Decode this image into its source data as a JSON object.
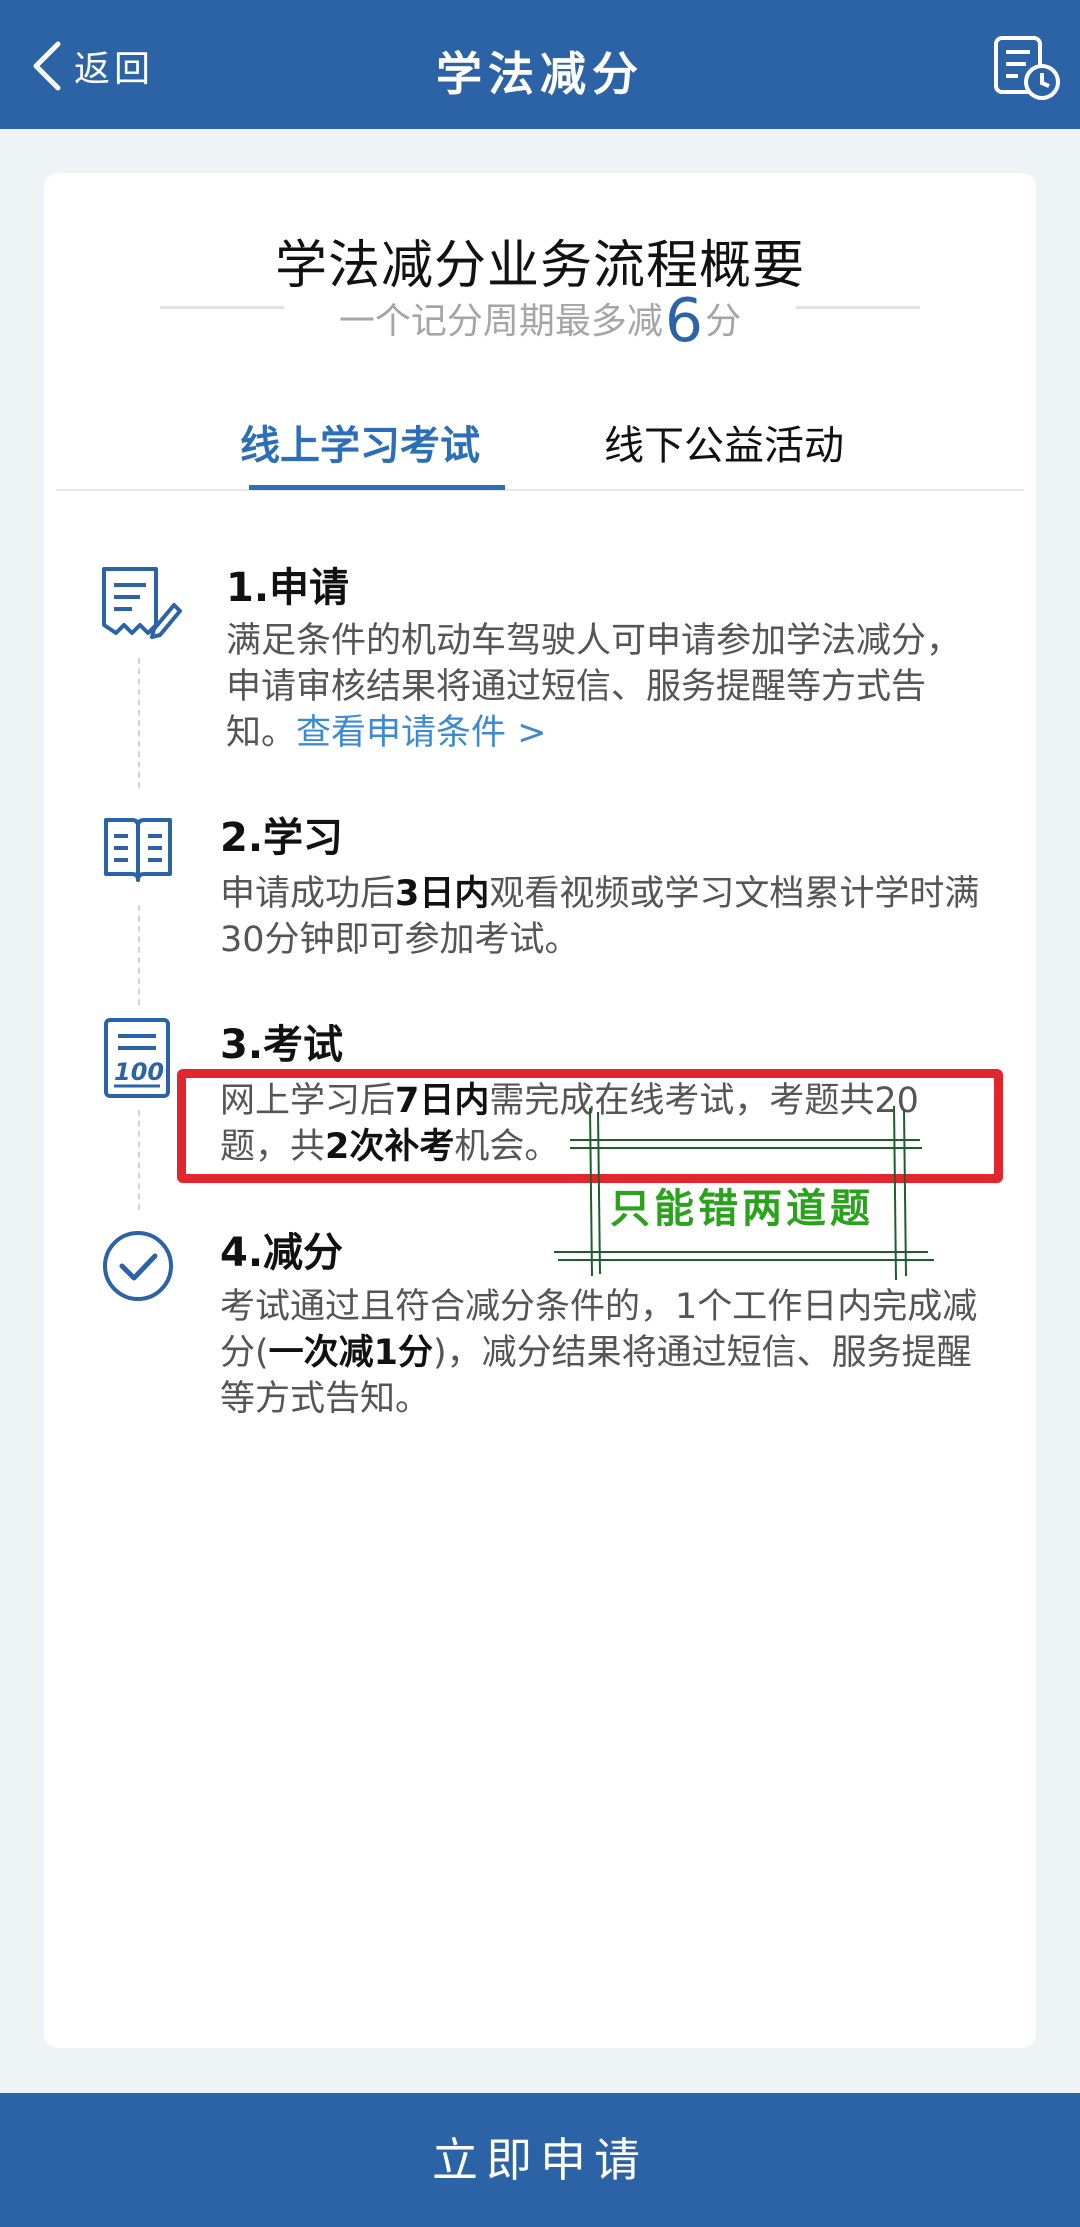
{
  "header": {
    "back_label": "返回",
    "title": "学法减分"
  },
  "card": {
    "title": "学法减分业务流程概要",
    "subtitle_prefix": "一个记分周期最多减",
    "subtitle_number": "6",
    "subtitle_suffix": "分"
  },
  "tabs": [
    {
      "label": "线上学习考试",
      "active": true
    },
    {
      "label": "线下公益活动",
      "active": false
    }
  ],
  "steps": [
    {
      "title": "1.申请",
      "desc": "满足条件的机动车驾驶人可申请参加学法减分，申请审核结果将通过短信、服务提醒等方式告知。",
      "link": "查看申请条件 >"
    },
    {
      "title": "2.学习",
      "desc_a": "申请成功后",
      "desc_b": "3日内",
      "desc_c": "观看视频或学习文档累计学时满30分钟即可参加考试。"
    },
    {
      "title": "3.考试",
      "desc_a": "网上学习后",
      "desc_b": "7日内",
      "desc_c": "需完成在线考试，考题共20题，共",
      "desc_d": "2次补考",
      "desc_e": "机会。"
    },
    {
      "title": "4.减分",
      "desc_a": "考试通过且符合减分条件的，1个工作日内完成减分(",
      "desc_b": "一次减1分",
      "desc_c": ")，减分结果将通过短信、服务提醒等方式告知。"
    }
  ],
  "annotation": {
    "note": "只能错两道题",
    "box_color": "#e3262e",
    "note_color": "#2aa21c"
  },
  "bottom": {
    "apply_label": "立即申请"
  },
  "colors": {
    "brand": "#2c63a6",
    "tab_active": "#2c6fb8",
    "link": "#3c8ad1"
  }
}
